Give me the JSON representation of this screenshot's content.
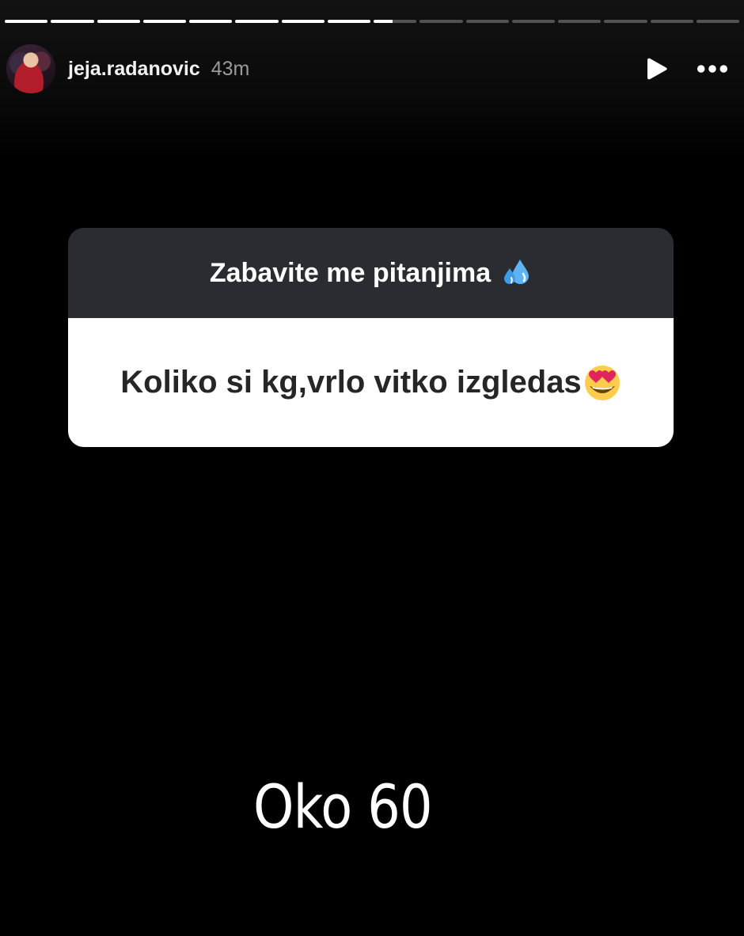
{
  "story": {
    "total_segments": 16,
    "viewed_segments": 8,
    "current_segment_progress": 0.45
  },
  "header": {
    "username": "jeja.radanovic",
    "time_ago": "43m",
    "play_icon": "play-icon",
    "more_icon": "more-horizontal-icon"
  },
  "question_sticker": {
    "prompt": "Zabavite me pitanjima",
    "prompt_emoji": "sweat-droplets-emoji",
    "question": "Koliko si kg,vrlo vitko izgledas",
    "question_emoji": "heart-eyes-emoji"
  },
  "answer": {
    "text": "Oko 60"
  },
  "colors": {
    "background": "#000000",
    "sticker_header": "#2a2c31",
    "sticker_body": "#ffffff",
    "question_text": "#262626",
    "timestamp": "#9a9a9a"
  }
}
